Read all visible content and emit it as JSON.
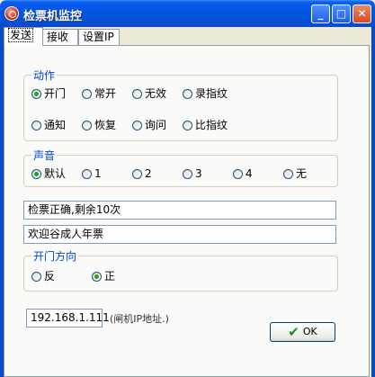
{
  "window": {
    "title": "检票机监控",
    "minimize": "_",
    "maximize": "□",
    "close": "✕"
  },
  "tabs": [
    {
      "label": "发送"
    },
    {
      "label": "接收"
    },
    {
      "label": "设置IP"
    }
  ],
  "action_group": {
    "legend": "动作",
    "options": [
      "开门",
      "常开",
      "无效",
      "录指纹",
      "通知",
      "恢复",
      "询问",
      "比指纹"
    ],
    "selected": "开门"
  },
  "sound_group": {
    "legend": "声音",
    "options": [
      "默认",
      "1",
      "2",
      "3",
      "4",
      "无"
    ],
    "selected": "默认"
  },
  "message1": "检票正确,剩余10次",
  "message2": "欢迎谷成人年票",
  "direction_group": {
    "legend": "开门方向",
    "options": [
      "反",
      "正"
    ],
    "selected": "正"
  },
  "ip": {
    "value": "192.168.1.111",
    "hint": "(闸机IP地址.)"
  },
  "ok_button": {
    "label": "OK",
    "icon": "checkmark-icon"
  }
}
